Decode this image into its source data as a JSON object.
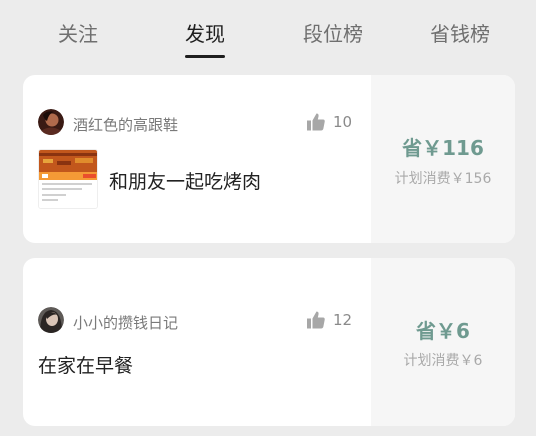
{
  "tabs": [
    {
      "label": "关注"
    },
    {
      "label": "发现"
    },
    {
      "label": "段位榜"
    },
    {
      "label": "省钱榜"
    }
  ],
  "active_tab_index": 1,
  "posts": [
    {
      "username": "酒红色的高跟鞋",
      "likes": "10",
      "title": "和朋友一起吃烤肉",
      "save": "省￥116",
      "plan": "计划消费￥156",
      "has_image": true,
      "avatar_icon": "avatar-dark-red"
    },
    {
      "username": "小小的攒钱日记",
      "likes": "12",
      "title": "在家在早餐",
      "save": "省￥6",
      "plan": "计划消费￥6",
      "has_image": false,
      "avatar_icon": "avatar-portrait"
    }
  ],
  "colors": {
    "accent_green": "#6f9a90",
    "active_tab": "#1e1e1e",
    "inactive_tab": "#6f6f6f",
    "background": "#ececec"
  },
  "icons": {
    "like": "thumbs-up-icon"
  }
}
